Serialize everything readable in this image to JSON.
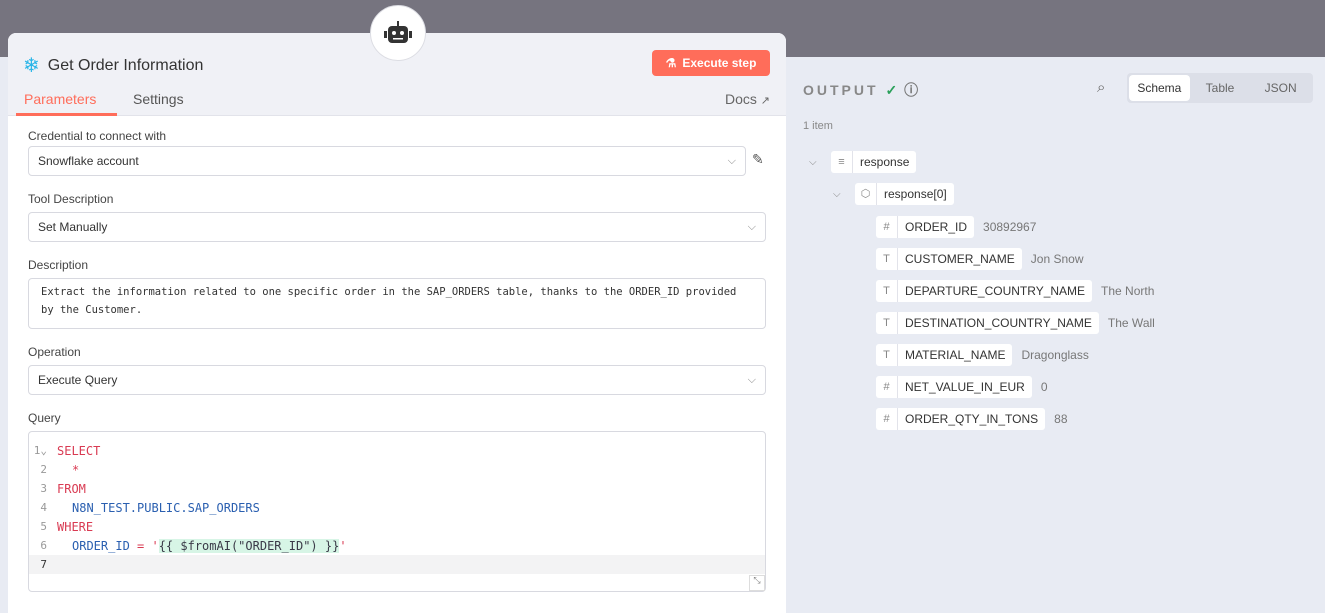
{
  "node": {
    "title": "Get Order Information",
    "execute_label": "Execute step"
  },
  "tabs": [
    "Parameters",
    "Settings"
  ],
  "docs_label": "Docs",
  "form": {
    "credential_label": "Credential to connect with",
    "credential_value": "Snowflake account",
    "tool_desc_label": "Tool Description",
    "tool_desc_value": "Set Manually",
    "description_label": "Description",
    "description_value": "Extract the information related to one specific order in the SAP_ORDERS table, thanks to the ORDER_ID provided by the Customer.",
    "operation_label": "Operation",
    "operation_value": "Execute Query",
    "query_label": "Query"
  },
  "query": {
    "l1": "SELECT",
    "l2": "*",
    "l3": "FROM",
    "l4": "N8N_TEST.PUBLIC.SAP_ORDERS",
    "l5": "WHERE",
    "l6a": "ORDER_ID",
    "l6b": " = '",
    "l6c": "{{ $fromAI(\"ORDER_ID\") }}",
    "l6d": "'"
  },
  "output": {
    "title": "OUTPUT",
    "views": [
      "Schema",
      "Table",
      "JSON"
    ],
    "count": "1 item",
    "root": "response",
    "child": "response[0]",
    "fields": [
      {
        "type": "#",
        "key": "ORDER_ID",
        "value": "30892967"
      },
      {
        "type": "T",
        "key": "CUSTOMER_NAME",
        "value": "Jon Snow"
      },
      {
        "type": "T",
        "key": "DEPARTURE_COUNTRY_NAME",
        "value": "The North"
      },
      {
        "type": "T",
        "key": "DESTINATION_COUNTRY_NAME",
        "value": "The Wall"
      },
      {
        "type": "T",
        "key": "MATERIAL_NAME",
        "value": "Dragonglass"
      },
      {
        "type": "#",
        "key": "NET_VALUE_IN_EUR",
        "value": "0"
      },
      {
        "type": "#",
        "key": "ORDER_QTY_IN_TONS",
        "value": "88"
      }
    ]
  }
}
